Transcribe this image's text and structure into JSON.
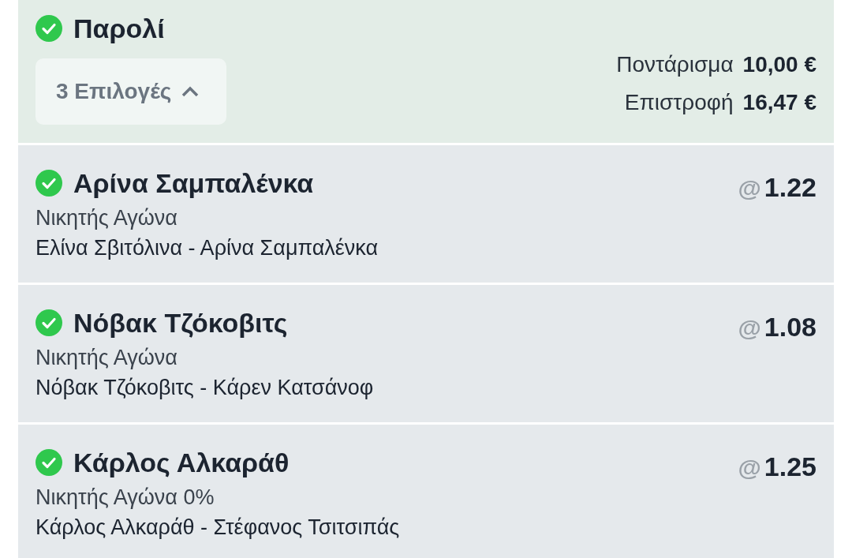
{
  "slip": {
    "title": "Παρολί",
    "won": true,
    "toggle": {
      "label": "3 Επιλογές",
      "expanded": true
    },
    "totals": [
      {
        "label": "Ποντάρισμα",
        "value": "10,00 €"
      },
      {
        "label": "Επιστροφή",
        "value": "16,47 €"
      }
    ]
  },
  "selections": [
    {
      "name": "Αρίνα Σαμπαλένκα",
      "won": true,
      "at": "@",
      "odds": "1.22",
      "market": "Νικητής Αγώνα",
      "event": "Ελίνα Σβιτόλινα - Αρίνα Σαμπαλένκα"
    },
    {
      "name": "Νόβακ Τζόκοβιτς",
      "won": true,
      "at": "@",
      "odds": "1.08",
      "market": "Νικητής Αγώνα",
      "event": "Νόβακ Τζόκοβιτς - Κάρεν Κατσάνοφ"
    },
    {
      "name": "Κάρλος Αλκαράθ",
      "won": true,
      "at": "@",
      "odds": "1.25",
      "market": "Νικητής Αγώνα 0%",
      "event": "Κάρλος Αλκαράθ - Στέφανος Τσιτσιπάς"
    }
  ]
}
